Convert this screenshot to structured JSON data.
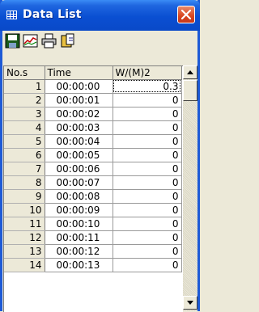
{
  "window": {
    "title": "Data List"
  },
  "toolbar": {
    "buttons": [
      {
        "icon": "save-icon"
      },
      {
        "icon": "chart-icon"
      },
      {
        "icon": "print-icon"
      },
      {
        "icon": "export-icon"
      }
    ]
  },
  "grid": {
    "columns": [
      "No.s",
      "Time",
      "W/(M)2"
    ],
    "rows": [
      {
        "no": "1",
        "time": "00:00:00",
        "value": "0.3"
      },
      {
        "no": "2",
        "time": "00:00:01",
        "value": "0"
      },
      {
        "no": "3",
        "time": "00:00:02",
        "value": "0"
      },
      {
        "no": "4",
        "time": "00:00:03",
        "value": "0"
      },
      {
        "no": "5",
        "time": "00:00:04",
        "value": "0"
      },
      {
        "no": "6",
        "time": "00:00:05",
        "value": "0"
      },
      {
        "no": "7",
        "time": "00:00:06",
        "value": "0"
      },
      {
        "no": "8",
        "time": "00:00:07",
        "value": "0"
      },
      {
        "no": "9",
        "time": "00:00:08",
        "value": "0"
      },
      {
        "no": "10",
        "time": "00:00:09",
        "value": "0"
      },
      {
        "no": "11",
        "time": "00:00:10",
        "value": "0"
      },
      {
        "no": "12",
        "time": "00:00:11",
        "value": "0"
      },
      {
        "no": "13",
        "time": "00:00:12",
        "value": "0"
      },
      {
        "no": "14",
        "time": "00:00:13",
        "value": "0"
      }
    ]
  },
  "colors": {
    "titlebar": "#0a4fd2",
    "close": "#d8461f",
    "face": "#ece9d8"
  }
}
